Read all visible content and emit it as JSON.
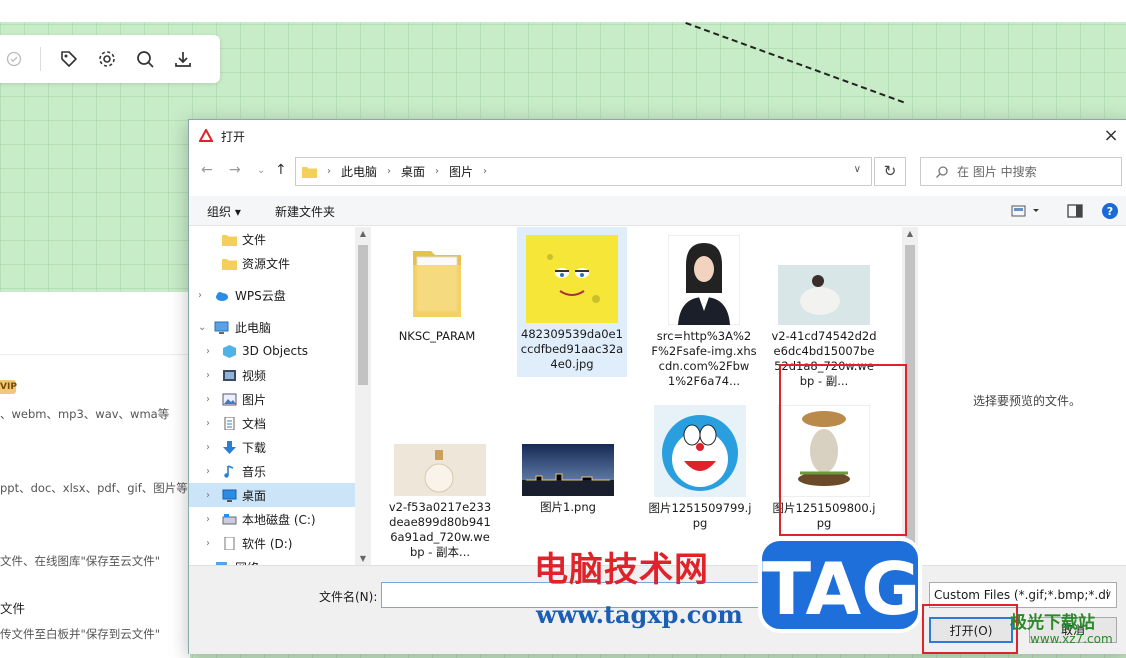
{
  "dialog": {
    "title": "打开",
    "close": "×",
    "nav": {
      "back": "←",
      "forward": "→",
      "recent": "⌄",
      "up": "↑"
    },
    "breadcrumb": [
      "此电脑",
      "桌面",
      "图片"
    ],
    "refresh": "↻",
    "search_placeholder": "在 图片 中搜索",
    "commands": {
      "organize": "组织 ▾",
      "new_folder": "新建文件夹"
    },
    "tree": [
      {
        "label": "文件",
        "icon": "folder-icon"
      },
      {
        "label": "资源文件",
        "icon": "folder-icon"
      },
      {
        "label": "WPS云盘",
        "icon": "cloud-icon"
      },
      {
        "label": "此电脑",
        "icon": "computer-icon"
      },
      {
        "label": "3D Objects",
        "icon": "cube-icon"
      },
      {
        "label": "视频",
        "icon": "video-icon"
      },
      {
        "label": "图片",
        "icon": "picture-icon"
      },
      {
        "label": "文档",
        "icon": "document-icon"
      },
      {
        "label": "下载",
        "icon": "download-icon"
      },
      {
        "label": "音乐",
        "icon": "music-icon"
      },
      {
        "label": "桌面",
        "icon": "desktop-icon"
      },
      {
        "label": "本地磁盘 (C:)",
        "icon": "drive-icon"
      },
      {
        "label": "软件 (D:)",
        "icon": "drive-icon"
      },
      {
        "label": "网络",
        "icon": "network-icon"
      }
    ],
    "files": [
      {
        "name": "NKSC_PARAM"
      },
      {
        "name": "482309539da0e1ccdfbed91aac32a4e0.jpg"
      },
      {
        "name": "src=http%3A%2F%2Fsafe-img.xhscdn.com%2Fbw1%2F6a74..."
      },
      {
        "name": "v2-41cd74542d2de6dc4bd15007be52d1a8_720w.webp - 副..."
      },
      {
        "name": "v2-f53a0217e233deae899d80b9416a91ad_720w.webp - 副本..."
      },
      {
        "name": "图片1.png"
      },
      {
        "name": "图片1251509799.jpg"
      },
      {
        "name": "图片1251509800.jpg"
      }
    ],
    "preview_text": "选择要预览的文件。",
    "filename_label": "文件名(N):",
    "filename_value": "",
    "filetype": "Custom Files (*.gif;*.bmp;*.di",
    "open_button": "打开(O)",
    "cancel_button": "取消"
  },
  "background_panel": {
    "vip": "VIP",
    "lines": [
      "、webm、mp3、wav、wma等",
      "ppt、doc、xlsx、pdf、gif、图片等",
      "文件、在线图库\"保存至云文件\"",
      "文件",
      "传文件至白板并\"保存到云文件\""
    ]
  },
  "watermark": {
    "cn": "电脑技术网",
    "url": "www.tagxp.com",
    "tag": "TAG",
    "site2": "极光下载站",
    "site2_url": "www.xz7.com"
  },
  "colors": {
    "accent": "#2b7cd3",
    "highlight": "#e0222a",
    "selection": "#cce4f7"
  }
}
